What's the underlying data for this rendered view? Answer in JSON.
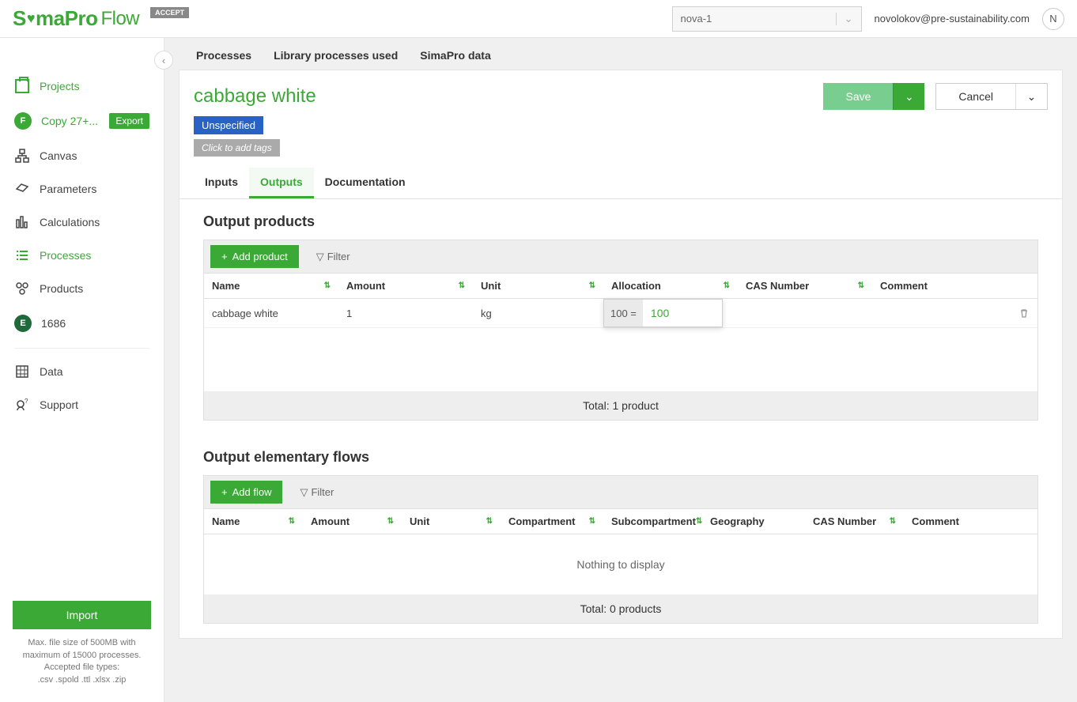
{
  "header": {
    "logo_main": "S",
    "logo_rest": "maPro",
    "logo_flow": "Flow",
    "accept": "ACCEPT",
    "project_selected": "nova-1",
    "user_email": "novolokov@pre-sustainability.com",
    "avatar_initial": "N"
  },
  "sidebar": {
    "projects": "Projects",
    "copy": "Copy 27+...",
    "export": "Export",
    "canvas": "Canvas",
    "parameters": "Parameters",
    "calculations": "Calculations",
    "processes": "Processes",
    "products": "Products",
    "badge_e": "E",
    "id_1686": "1686",
    "data": "Data",
    "support": "Support",
    "import": "Import",
    "import_note_1": "Max. file size of 500MB with",
    "import_note_2": "maximum of 15000 processes.",
    "import_note_3": "Accepted file types:",
    "import_note_4": ".csv .spold .ttl .xlsx .zip"
  },
  "breadcrumbs": {
    "processes": "Processes",
    "lib": "Library processes used",
    "sima": "SimaPro data"
  },
  "title": {
    "text": "cabbage white",
    "save": "Save",
    "cancel": "Cancel"
  },
  "tags": {
    "unspecified": "Unspecified",
    "add": "Click to add tags"
  },
  "tabs": {
    "inputs": "Inputs",
    "outputs": "Outputs",
    "documentation": "Documentation"
  },
  "products": {
    "title": "Output products",
    "add": "Add product",
    "filter": "Filter",
    "cols": {
      "name": "Name",
      "amount": "Amount",
      "unit": "Unit",
      "allocation": "Allocation",
      "cas": "CAS Number",
      "comment": "Comment"
    },
    "row": {
      "name": "cabbage white",
      "amount": "1",
      "unit": "kg"
    },
    "alloc_eq": "100 =",
    "alloc_val": "100",
    "total": "Total: 1 product"
  },
  "flows": {
    "title": "Output elementary flows",
    "add": "Add flow",
    "filter": "Filter",
    "cols": {
      "name": "Name",
      "amount": "Amount",
      "unit": "Unit",
      "compartment": "Compartment",
      "subcompartment": "Subcompartment",
      "geography": "Geography",
      "cas": "CAS Number",
      "comment": "Comment"
    },
    "empty": "Nothing to display",
    "total": "Total: 0 products"
  }
}
